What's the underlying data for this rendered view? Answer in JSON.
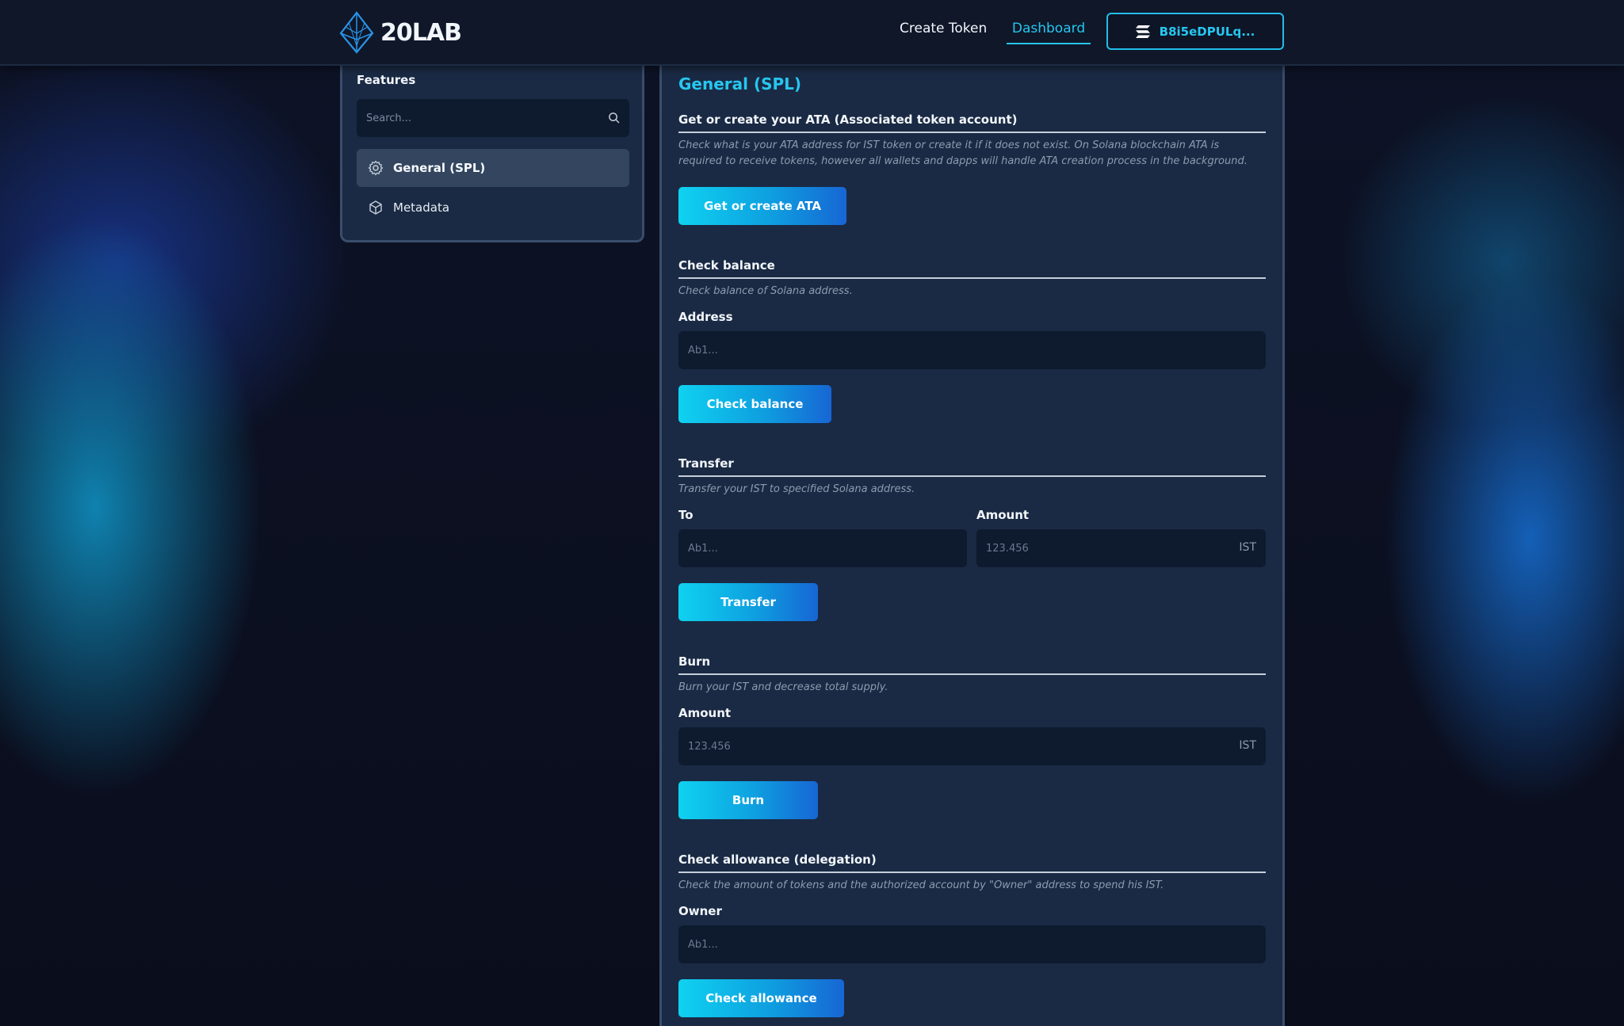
{
  "header": {
    "logo_text": "20LAB",
    "nav": {
      "create_token": "Create Token",
      "dashboard": "Dashboard"
    },
    "wallet": {
      "address": "B8i5eDPULq...",
      "icon": "solana-icon"
    }
  },
  "sidebar": {
    "title": "Features",
    "search_placeholder": "Search...",
    "items": [
      {
        "label": "General (SPL)",
        "icon": "gear-icon",
        "active": true
      },
      {
        "label": "Metadata",
        "icon": "cube-icon",
        "active": false
      }
    ]
  },
  "main": {
    "title": "General (SPL)",
    "ata": {
      "title": "Get or create your ATA (Associated token account)",
      "description": "Check what is your ATA address for IST token or create it if it does not exist. On Solana blockchain ATA is required to receive tokens, however all wallets and dapps will handle ATA creation process in the background.",
      "button": "Get or create ATA"
    },
    "balance": {
      "title": "Check balance",
      "description": "Check balance of Solana address.",
      "address_label": "Address",
      "address_placeholder": "Ab1...",
      "button": "Check balance"
    },
    "transfer": {
      "title": "Transfer",
      "description": "Transfer your IST to specified Solana address.",
      "to_label": "To",
      "to_placeholder": "Ab1...",
      "amount_label": "Amount",
      "amount_placeholder": "123.456",
      "unit": "IST",
      "button": "Transfer"
    },
    "burn": {
      "title": "Burn",
      "description": "Burn your IST and decrease total supply.",
      "amount_label": "Amount",
      "amount_placeholder": "123.456",
      "unit": "IST",
      "button": "Burn"
    },
    "allowance": {
      "title": "Check allowance (delegation)",
      "description": "Check the amount of tokens and the authorized account by \"Owner\" address to spend his IST.",
      "owner_label": "Owner",
      "owner_placeholder": "Ab1...",
      "button": "Check allowance"
    }
  },
  "colors": {
    "accent": "#27c6ef",
    "panel": "#1a2a44",
    "input": "#0e1a2e",
    "button_gradient_start": "#0fd2f0",
    "button_gradient_end": "#1766d4"
  }
}
